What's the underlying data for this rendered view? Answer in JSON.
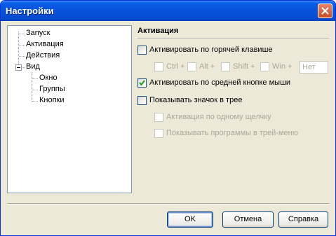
{
  "window": {
    "title": "Настройки"
  },
  "tree": {
    "items": [
      {
        "label": "Запуск"
      },
      {
        "label": "Активация"
      },
      {
        "label": "Действия"
      },
      {
        "label": "Вид"
      },
      {
        "label": "Окно"
      },
      {
        "label": "Группы"
      },
      {
        "label": "Кнопки"
      }
    ],
    "expanded": "Вид"
  },
  "activation": {
    "section_title": "Активация",
    "hotkey": {
      "label": "Активировать по горячей клавише",
      "checked": false
    },
    "modifiers": {
      "ctrl": "Ctrl +",
      "alt": "Alt +",
      "shift": "Shift +",
      "win": "Win +",
      "key_value": "Нет"
    },
    "middle_button": {
      "label": "Активировать по средней кнопке мыши",
      "checked": true
    },
    "tray_icon": {
      "label": "Показывать значок в трее",
      "checked": false
    },
    "single_click": {
      "label": "Активация по одному щелчку",
      "checked": false
    },
    "tray_menu": {
      "label": "Показывать программы в трей-меню",
      "checked": false
    }
  },
  "buttons": {
    "ok": "OK",
    "cancel": "Отмена",
    "help": "Справка"
  }
}
